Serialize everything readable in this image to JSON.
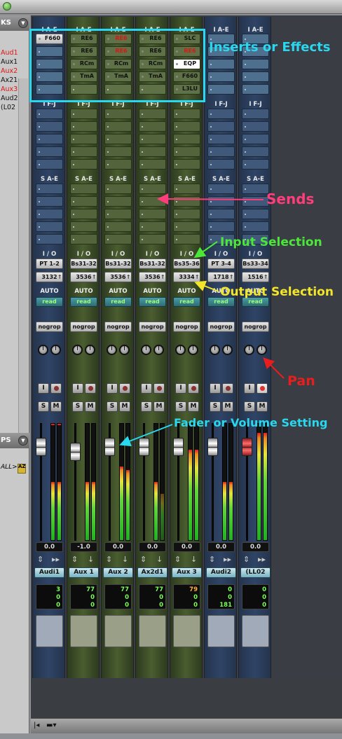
{
  "left_panel": {
    "tracks_title": "KS",
    "tracks": [
      {
        "name": "Aud1",
        "color": "#e01515"
      },
      {
        "name": "Aux1",
        "color": "#111111"
      },
      {
        "name": "Aux2",
        "color": "#e01515"
      },
      {
        "name": "Ax21",
        "color": "#111111"
      },
      {
        "name": "Aux3",
        "color": "#e01515"
      },
      {
        "name": "Aud2",
        "color": "#111111"
      },
      {
        "name": "(L02",
        "color": "#111111"
      }
    ],
    "groups_title": "PS",
    "groups_all": "ALL>",
    "groups_badge": "AZ"
  },
  "section_labels": {
    "inserts": "I A-E",
    "inserts_fj": "I F-J",
    "sends": "S A-E",
    "io": "I / O",
    "auto": "AUTO"
  },
  "strips": [
    {
      "type": "audio",
      "inserts": [
        "F660",
        "",
        "",
        "",
        ""
      ],
      "red": [
        false,
        false,
        false,
        false,
        false
      ],
      "input": "PT 1-2",
      "output": "3132",
      "auto": "read",
      "group": "nogrop",
      "volume": "0.0",
      "name": "Audi1",
      "levels": [
        0.5,
        0.5
      ],
      "peaks": [
        true,
        true
      ],
      "nums": [
        "3",
        "0",
        "0"
      ],
      "fader": 0.85,
      "fader_red": false,
      "rec_on": false
    },
    {
      "type": "aux",
      "inserts": [
        "RE6",
        "RE6",
        "RCm",
        "TmA",
        ""
      ],
      "red": [
        false,
        false,
        false,
        false,
        false
      ],
      "input": "Bs31-32",
      "output": "3536",
      "auto": "read",
      "group": "nogrop",
      "volume": "-1.0",
      "name": "Aux 1",
      "levels": [
        0.5,
        0.5
      ],
      "peaks": [
        false,
        false
      ],
      "nums": [
        "77",
        "0",
        "0"
      ],
      "fader": 0.8,
      "fader_red": false,
      "rec_on": false
    },
    {
      "type": "aux",
      "inserts": [
        "RE6",
        "RE6",
        "RCm",
        "TmA",
        ""
      ],
      "red": [
        true,
        true,
        false,
        false,
        false
      ],
      "input": "Bs31-32",
      "output": "3536",
      "auto": "read",
      "group": "nogrop",
      "volume": "0.0",
      "name": "Aux 2",
      "levels": [
        0.63,
        0.6
      ],
      "peaks": [
        false,
        false
      ],
      "nums": [
        "77",
        "0",
        "0"
      ],
      "fader": 0.85,
      "fader_red": false,
      "rec_on": false
    },
    {
      "type": "aux",
      "inserts": [
        "RE6",
        "RE6",
        "RCm",
        "TmA",
        ""
      ],
      "red": [
        false,
        false,
        false,
        false,
        false
      ],
      "input": "Bs31-32",
      "output": "3536",
      "auto": "read",
      "group": "nogrop",
      "volume": "0.0",
      "name": "Ax2d1",
      "levels": [
        0.5,
        0.4
      ],
      "peaks": [
        false,
        false
      ],
      "nums": [
        "77",
        "0",
        "0"
      ],
      "fader": 0.85,
      "fader_red": false,
      "rec_on": false
    },
    {
      "type": "aux",
      "inserts": [
        "SLC",
        "RE6",
        "EQP",
        "F660",
        "L3LU"
      ],
      "red": [
        false,
        true,
        false,
        false,
        false
      ],
      "active": [
        false,
        false,
        true,
        false,
        false
      ],
      "input": "Bs35-36",
      "output": "3334",
      "auto": "read",
      "group": "nogrop",
      "volume": "0.0",
      "name": "Aux 3",
      "levels": [
        0.78,
        0.78
      ],
      "peaks": [
        false,
        false
      ],
      "nums": [
        "79",
        "0",
        "0"
      ],
      "nums_amber": [
        true,
        false,
        false
      ],
      "fader": 0.85,
      "fader_red": false,
      "rec_on": false
    },
    {
      "type": "audio",
      "inserts": [
        "",
        "",
        "",
        "",
        ""
      ],
      "red": [
        false,
        false,
        false,
        false,
        false
      ],
      "input": "PT 3-4",
      "output": "1718",
      "auto": "read",
      "group": "nogrop",
      "volume": "0.0",
      "name": "Audi2",
      "levels": [
        0.5,
        0.5
      ],
      "peaks": [
        false,
        false
      ],
      "nums": [
        "0",
        "0",
        "181"
      ],
      "fader": 0.85,
      "fader_red": false,
      "rec_on": false
    },
    {
      "type": "audio",
      "inserts": [
        "",
        "",
        "",
        "",
        ""
      ],
      "red": [
        false,
        false,
        false,
        false,
        false
      ],
      "input": "Bs33-34",
      "output": "1516",
      "auto": "read",
      "group": "nogrop",
      "volume": "0.0",
      "name": "(LL02",
      "levels": [
        0.92,
        0.92
      ],
      "peaks": [
        false,
        false
      ],
      "nums": [
        "0",
        "0",
        "0"
      ],
      "fader": 0.85,
      "fader_red": true,
      "rec_on": true
    }
  ],
  "annotations": [
    {
      "text": "Inserts or Effects",
      "color": "#29d7ef"
    },
    {
      "text": "Sends",
      "color": "#ff3d7a"
    },
    {
      "text": "Input Selection",
      "color": "#4be83a"
    },
    {
      "text": "Output Selection",
      "color": "#f2e52a"
    },
    {
      "text": "Pan",
      "color": "#e81e1e"
    },
    {
      "text": "Fader or Volume Setting",
      "color": "#29d7ef"
    }
  ]
}
